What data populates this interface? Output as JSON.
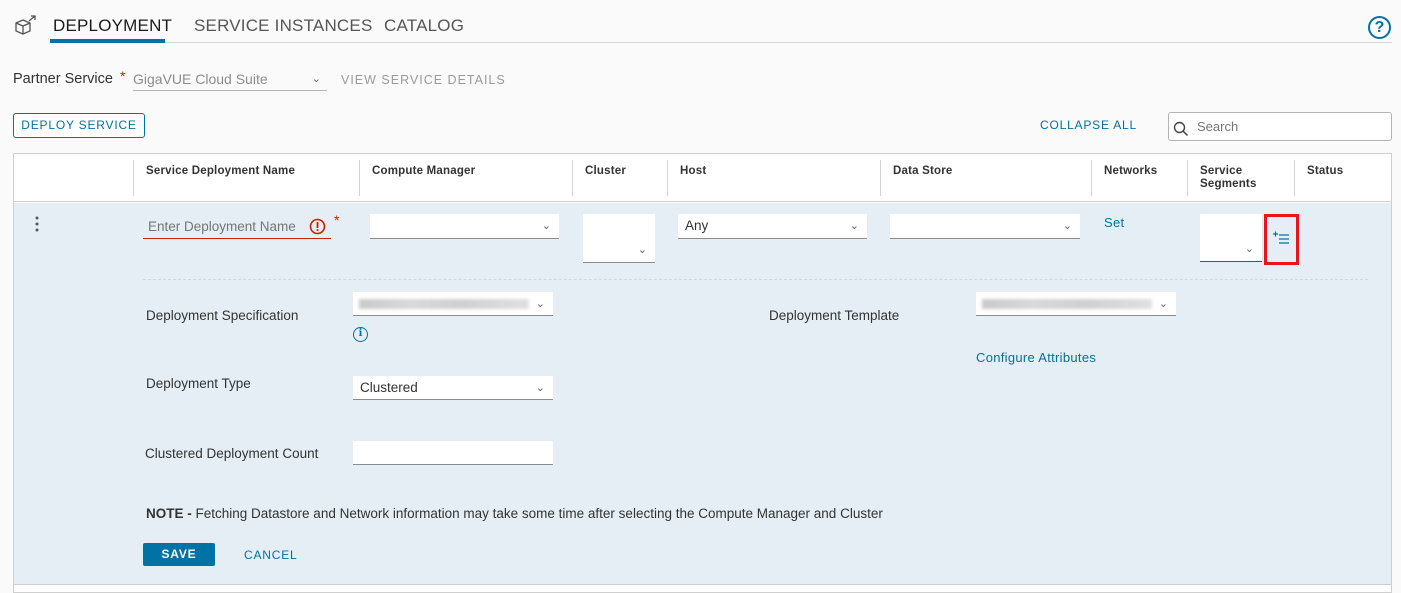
{
  "tabs": [
    {
      "label": "DEPLOYMENT",
      "active": true
    },
    {
      "label": "SERVICE INSTANCES",
      "active": false
    },
    {
      "label": "CATALOG",
      "active": false
    }
  ],
  "help_label": "?",
  "partner_service": {
    "label": "Partner Service",
    "required_mark": "*",
    "value": "GigaVUE Cloud Suite",
    "view_details": "VIEW SERVICE DETAILS"
  },
  "toolbar": {
    "deploy_button": "DEPLOY SERVICE",
    "collapse_all": "COLLAPSE ALL",
    "search_placeholder": "Search"
  },
  "columns": {
    "name": "Service Deployment Name",
    "compute_manager": "Compute Manager",
    "cluster": "Cluster",
    "host": "Host",
    "data_store": "Data Store",
    "networks": "Networks",
    "service_segments_1": "Service",
    "service_segments_2": "Segments",
    "status": "Status"
  },
  "row": {
    "name_placeholder": "Enter Deployment Name",
    "required_mark": "*",
    "host_value": "Any",
    "networks_link": "Set"
  },
  "details": {
    "spec_label": "Deployment Specification",
    "template_label": "Deployment Template",
    "configure_attributes": "Configure Attributes",
    "type_label": "Deployment Type",
    "type_value": "Clustered",
    "count_label": "Clustered Deployment Count",
    "count_value": "",
    "note_bold": "NOTE -",
    "note_text": " Fetching Datastore and Network information may take some time after selecting the Compute Manager and Cluster",
    "save": "SAVE",
    "cancel": "CANCEL"
  },
  "colors": {
    "accent": "#0072a3",
    "error": "#c92100",
    "highlight_box": "#e8141c",
    "row_bg": "#e4eef4"
  }
}
